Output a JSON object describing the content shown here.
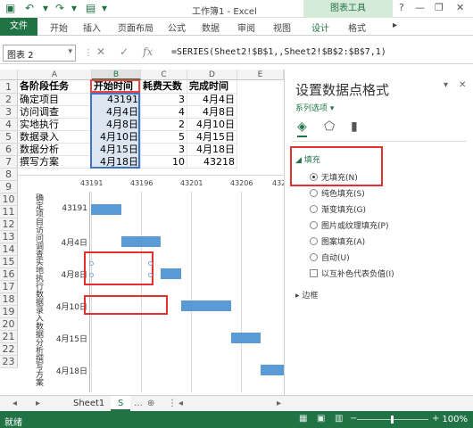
{
  "titlebar": {
    "title": "工作簿1 - Excel",
    "context_tab": "图表工具",
    "help": "?",
    "minimize": "—",
    "restore": "❐",
    "close": "✕"
  },
  "ribbon": {
    "file": "文件",
    "tabs": [
      "开始",
      "插入",
      "页面布局",
      "公式",
      "数据",
      "审阅",
      "视图",
      "设计",
      "格式"
    ]
  },
  "formula_bar": {
    "name_box": "图表 2",
    "formula": "=SERIES(Sheet2!$B$1,,Sheet2!$B$2:$B$7,1)"
  },
  "sheet": {
    "columns": [
      "A",
      "B",
      "C",
      "D",
      "E"
    ],
    "rows": [
      "1",
      "2",
      "3",
      "4",
      "5",
      "6",
      "7",
      "8",
      "9",
      "10",
      "11",
      "12",
      "13",
      "14",
      "15",
      "16",
      "17",
      "18",
      "19",
      "20",
      "21",
      "22",
      "23"
    ],
    "header": [
      "各阶段任务",
      "开始时间",
      "耗费天数",
      "完成时间"
    ],
    "data": [
      [
        "确定项目",
        "43191",
        "3",
        "4月4日"
      ],
      [
        "访问调查",
        "4月4日",
        "4",
        "4月8日"
      ],
      [
        "实地执行",
        "4月8日",
        "2",
        "4月10日"
      ],
      [
        "数据录入",
        "4月10日",
        "5",
        "4月15日"
      ],
      [
        "数据分析",
        "4月15日",
        "3",
        "4月18日"
      ],
      [
        "撰写方案",
        "4月18日",
        "10",
        "43218"
      ]
    ]
  },
  "chart": {
    "axis_ticks": [
      "43191",
      "43196",
      "43201",
      "43206",
      "43211"
    ],
    "categories": [
      {
        "rot": "确定项目",
        "date": "43191"
      },
      {
        "rot": "访问调查",
        "date": "4月4日"
      },
      {
        "rot": "实地执行",
        "date": "4月8日"
      },
      {
        "rot": "数据录入",
        "date": "4月10日"
      },
      {
        "rot": "数据分析",
        "date": "4月15日"
      },
      {
        "rot": "撰写方案",
        "date": "4月18日"
      }
    ]
  },
  "chart_data": {
    "type": "bar",
    "orientation": "horizontal",
    "categories": [
      "确定项目",
      "访问调查",
      "实地执行",
      "数据录入",
      "数据分析",
      "撰写方案"
    ],
    "x_ticks": [
      43191,
      43196,
      43201,
      43206,
      43211
    ],
    "xlim": [
      43191,
      43215
    ],
    "series": [
      {
        "values": [
          43191,
          43194,
          43198,
          43200,
          43205,
          43208
        ],
        "fill": "none"
      },
      {
        "values": [
          3,
          4,
          2,
          5,
          3,
          10
        ],
        "fill": "#5b9bd5"
      }
    ]
  },
  "pane": {
    "title": "设置数据点格式",
    "series_options": "系列选项",
    "fill_section": "填充",
    "border_section": "边框",
    "options": [
      "无填充(N)",
      "纯色填充(S)",
      "渐变填充(G)",
      "图片或纹理填充(P)",
      "图案填充(A)",
      "自动(U)"
    ],
    "invert": "以互补色代表负值(I)",
    "selected": "无填充(N)"
  },
  "sheet_tabs": {
    "tabs": [
      "Sheet1",
      "S"
    ],
    "active": "S"
  },
  "status": {
    "ready": "就绪",
    "zoom": "100%"
  },
  "colors": {
    "accent": "#217346",
    "bar": "#5b9bd5",
    "highlight": "#e03030"
  }
}
